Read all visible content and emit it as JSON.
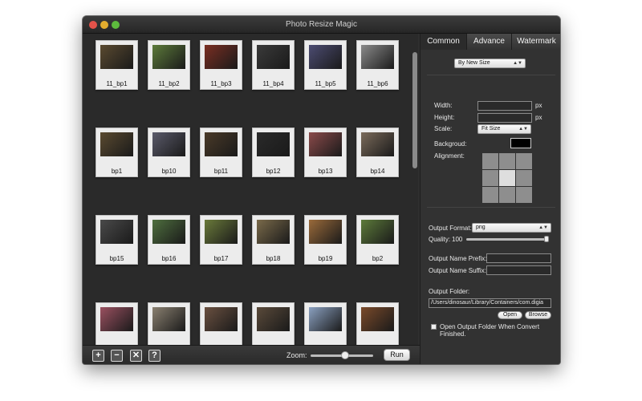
{
  "window": {
    "title": "Photo Resize Magic"
  },
  "thumbnails": [
    {
      "label": "11_bp1",
      "color": "#5a4a30"
    },
    {
      "label": "11_bp2",
      "color": "#5c7a3a"
    },
    {
      "label": "11_bp3",
      "color": "#7a2e22"
    },
    {
      "label": "11_bp4",
      "color": "#3a3a3a"
    },
    {
      "label": "11_bp5",
      "color": "#4c4c72"
    },
    {
      "label": "11_bp6",
      "color": "#8a8a8a"
    },
    {
      "label": "bp1",
      "color": "#5a4a30"
    },
    {
      "label": "bp10",
      "color": "#5a5a6a"
    },
    {
      "label": "bp11",
      "color": "#4a3a28"
    },
    {
      "label": "bp12",
      "color": "#2a2a2a"
    },
    {
      "label": "bp13",
      "color": "#8a4a4a"
    },
    {
      "label": "bp14",
      "color": "#7a6a5a"
    },
    {
      "label": "bp15",
      "color": "#4a4a4a"
    },
    {
      "label": "bp16",
      "color": "#4e6e3e"
    },
    {
      "label": "bp17",
      "color": "#6a7a3a"
    },
    {
      "label": "bp18",
      "color": "#7a6a4a"
    },
    {
      "label": "bp19",
      "color": "#9a6a3a"
    },
    {
      "label": "bp2",
      "color": "#5c7a3a"
    },
    {
      "label": "",
      "color": "#9a5060"
    },
    {
      "label": "",
      "color": "#8a8070"
    },
    {
      "label": "",
      "color": "#6a5040"
    },
    {
      "label": "",
      "color": "#5a4a3a"
    },
    {
      "label": "",
      "color": "#8aa0c0"
    },
    {
      "label": "",
      "color": "#7a4a2a"
    }
  ],
  "toolbar": {
    "add": "+",
    "remove": "−",
    "clear": "✕",
    "help": "?",
    "zoom_label": "Zoom:",
    "zoom_fraction": 0.55,
    "run_label": "Run"
  },
  "tabs": [
    {
      "label": "Common",
      "active": true
    },
    {
      "label": "Advance",
      "active": false
    },
    {
      "label": "Watermark",
      "active": false
    }
  ],
  "settings": {
    "resize_mode": "By New Size",
    "width_label": "Width:",
    "height_label": "Height:",
    "width_value": "",
    "height_value": "",
    "unit": "px",
    "scale_label": "Scale:",
    "scale_value": "Fit Size",
    "background_label": "Backgroud:",
    "background_color": "#000000",
    "alignment_label": "Alignment:",
    "alignment_selected": 4,
    "output_format_label": "Output Format:",
    "output_format_value": "png",
    "quality_label": "Quality:",
    "quality_value": "100",
    "prefix_label": "Output Name Prefix:",
    "prefix_value": "",
    "suffix_label": "Output Name Suffix:",
    "suffix_value": "",
    "folder_label": "Output Folder:",
    "folder_value": "/Users/dinosaur/Library/Containers/com.digia",
    "open_label": "Open",
    "browse_label": "Browse",
    "open_when_finished_label": "Open Output Folder When Convert Finished.",
    "open_when_finished": false
  }
}
